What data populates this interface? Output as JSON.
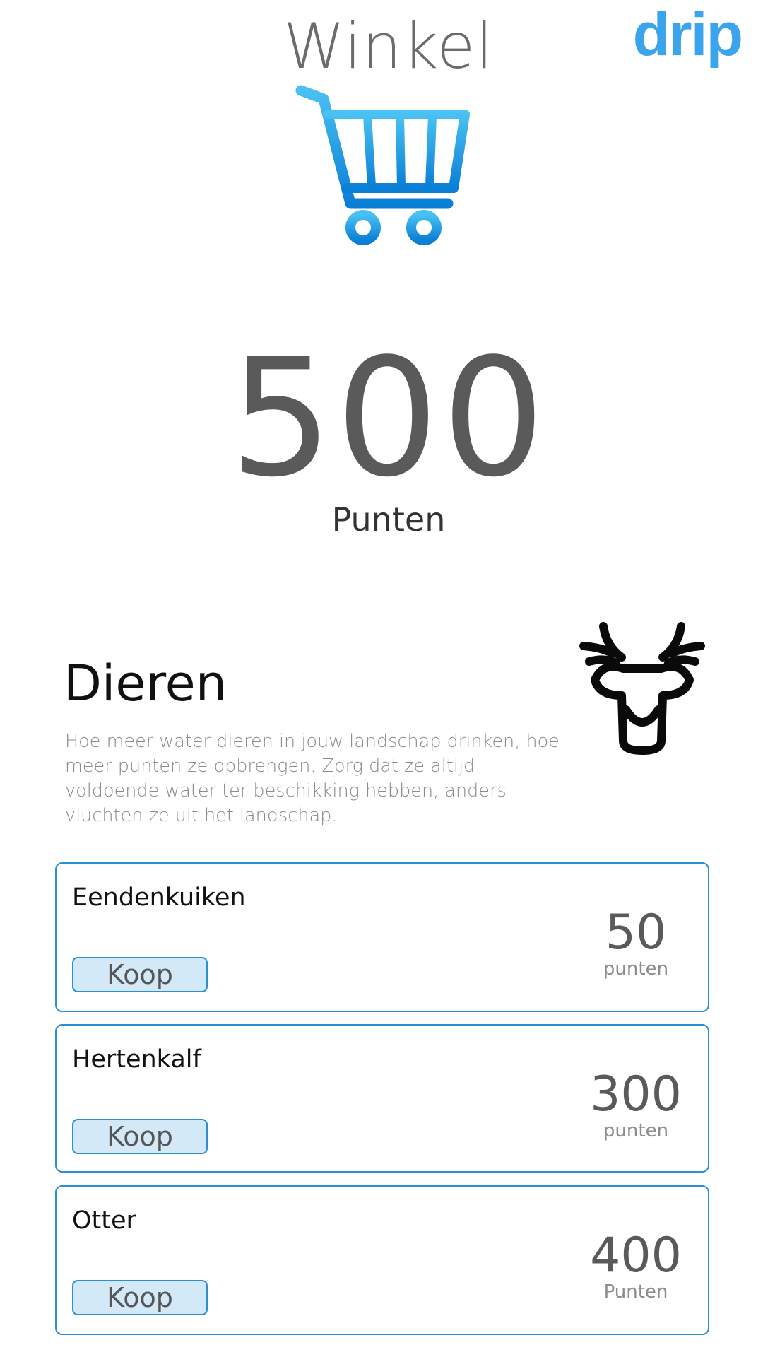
{
  "header": {
    "title": "Winkel",
    "logo_text": "drip"
  },
  "icons": {
    "cart": "shopping-cart-icon",
    "deer": "deer-icon"
  },
  "colors": {
    "accent": "#2b8fd3",
    "logo": "#3aa4ec",
    "button_bg": "#d3e9f8",
    "cart_gradient_top": "#49c1f2",
    "cart_gradient_bottom": "#0a7fd6"
  },
  "balance": {
    "value": "500",
    "unit": "Punten"
  },
  "section": {
    "heading": "Dieren",
    "description": "Hoe meer water dieren in jouw landschap drinken, hoe meer punten ze opbrengen. Zorg dat ze altijd voldoende water ter beschikking hebben, anders vluchten ze uit het landschap."
  },
  "items": [
    {
      "name": "Eendenkuiken",
      "button_label": "Koop",
      "price": "50",
      "price_unit": "punten"
    },
    {
      "name": "Hertenkalf",
      "button_label": "Koop",
      "price": "300",
      "price_unit": "punten"
    },
    {
      "name": "Otter",
      "button_label": "Koop",
      "price": "400",
      "price_unit": "Punten"
    }
  ]
}
